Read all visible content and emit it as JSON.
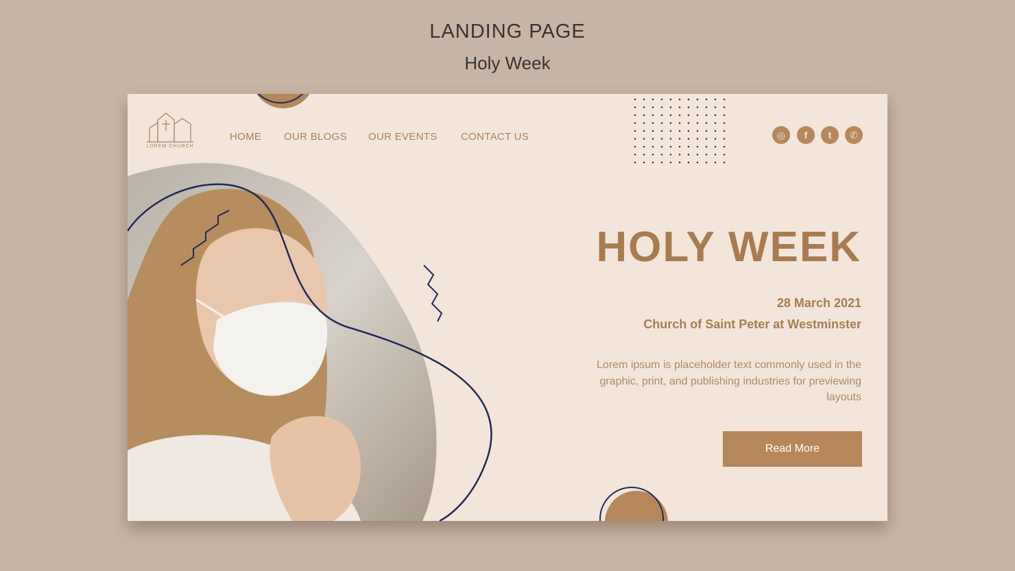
{
  "page": {
    "title": "LANDING PAGE",
    "subtitle": "Holy Week"
  },
  "logo": {
    "name": "LOREM CHURCH"
  },
  "nav": {
    "items": [
      {
        "label": "HOME"
      },
      {
        "label": "OUR BLOGS"
      },
      {
        "label": "OUR EVENTS"
      },
      {
        "label": "CONTACT US"
      }
    ]
  },
  "social": {
    "icons": [
      "instagram-icon",
      "facebook-icon",
      "twitter-icon",
      "whatsapp-icon"
    ],
    "glyphs": [
      "◎",
      "f",
      "t",
      "✆"
    ]
  },
  "hero": {
    "title": "HOLY WEEK",
    "date": "28 March 2021",
    "place": "Church of Saint Peter at Westminster",
    "description": "Lorem ipsum is placeholder text commonly used in the graphic, print, and publishing industries for previewing layouts",
    "button_label": "Read More"
  },
  "colors": {
    "background": "#c8b4a4",
    "card": "#f3e5da",
    "accent": "#b5875a",
    "text_brown": "#a87c50",
    "line_navy": "#1f2a55"
  }
}
